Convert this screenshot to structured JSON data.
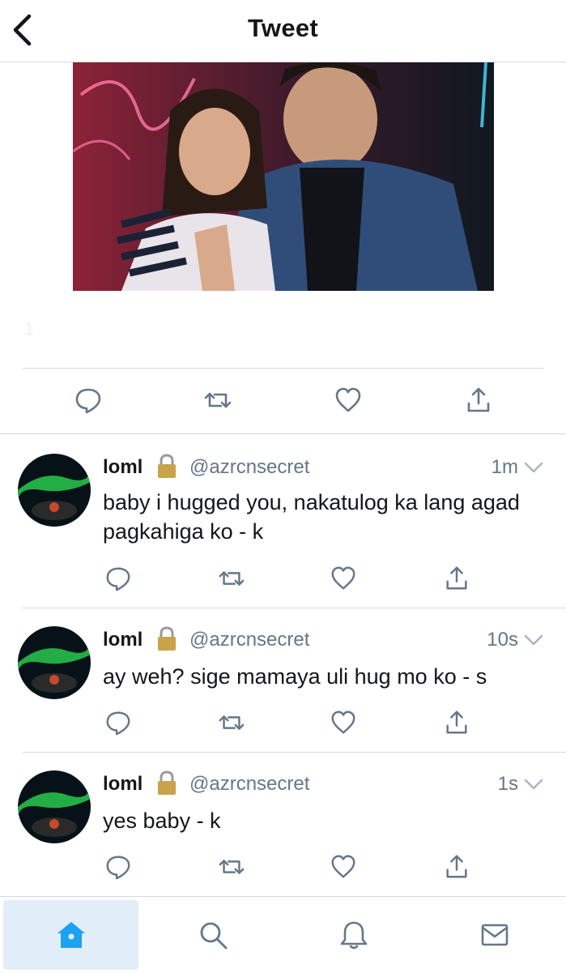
{
  "header": {
    "title": "Tweet",
    "back_icon": "chevron-left-icon"
  },
  "main_tweet": {
    "faint_count": "1",
    "actions": [
      "reply-icon",
      "retweet-icon",
      "like-icon",
      "share-icon"
    ]
  },
  "replies": [
    {
      "name": "loml",
      "handle": "@azrcnsecret",
      "time": "1m",
      "text": "baby i hugged you, nakatulog ka lang agad pagkahiga ko - k"
    },
    {
      "name": "loml",
      "handle": "@azrcnsecret",
      "time": "10s",
      "text": "ay weh? sige mamaya uli hug mo ko - s"
    },
    {
      "name": "loml",
      "handle": "@azrcnsecret",
      "time": "1s",
      "text": "yes baby - k"
    }
  ],
  "tabbar": {
    "tabs": [
      "home-icon",
      "search-icon",
      "notifications-icon",
      "messages-icon"
    ],
    "active": "home-icon",
    "accent": "#1da1f2"
  },
  "colors": {
    "secondary_text": "#657786",
    "icon_gray": "#657786",
    "divider": "#d5d9dc"
  }
}
